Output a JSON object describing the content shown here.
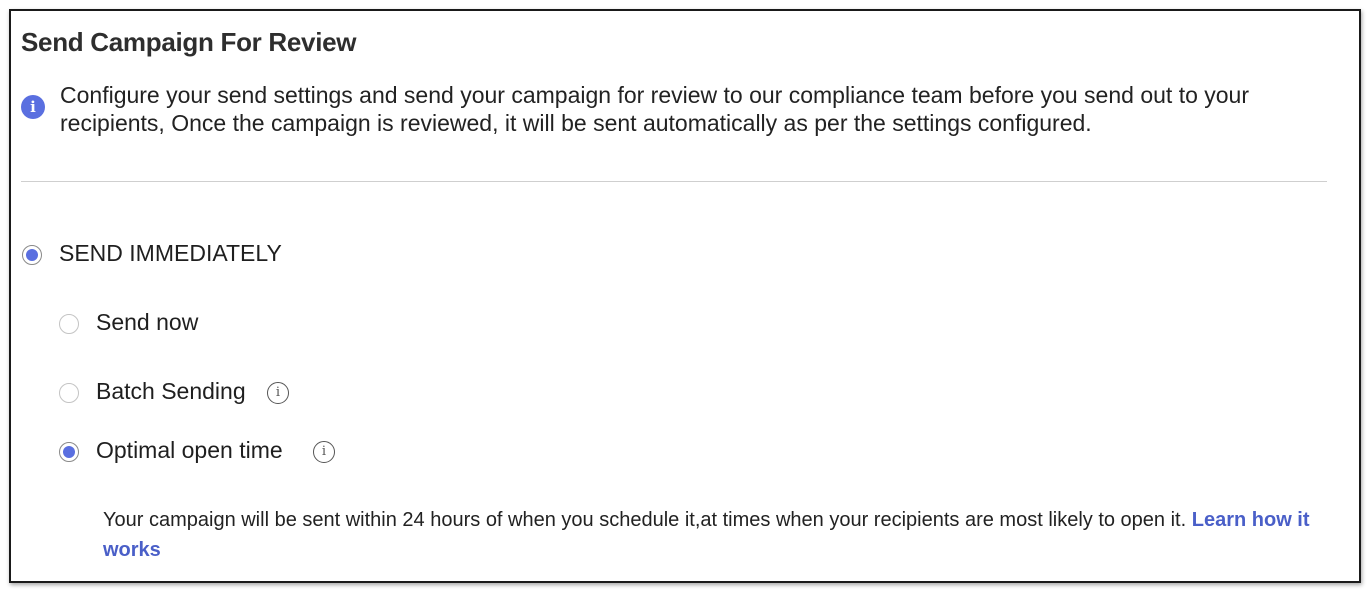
{
  "dialog": {
    "title": "Send Campaign For Review",
    "info_icon": "info-icon",
    "info_text": "Configure your send settings and send your campaign for review to our compliance team before you send out to your recipients, Once the campaign is reviewed, it will be sent automatically as per the settings configured."
  },
  "send_mode": {
    "label": "SEND IMMEDIATELY",
    "selected": true
  },
  "options": [
    {
      "label": "Send now",
      "selected": false,
      "has_help": false
    },
    {
      "label": "Batch Sending",
      "selected": false,
      "has_help": true,
      "help_icon": "info-outline-icon"
    },
    {
      "label": "Optimal open time",
      "selected": true,
      "has_help": true,
      "help_icon": "info-outline-icon"
    }
  ],
  "note": {
    "text": "Your campaign will be sent within 24 hours of when you schedule it,at times when your recipients are most likely to open it. ",
    "link": "Learn how it works"
  },
  "colors": {
    "accent": "#5a6fe0",
    "link": "#4a5fc8",
    "divider": "#cfcfcf"
  }
}
